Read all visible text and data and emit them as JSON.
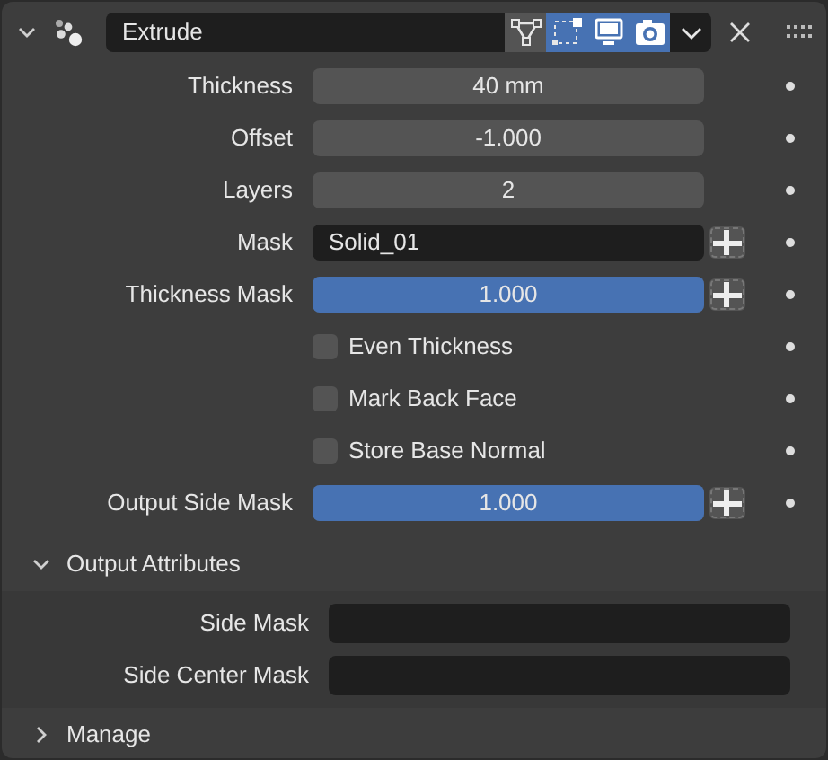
{
  "modifier": {
    "name": "Extrude",
    "expanded": true,
    "toggles": [
      {
        "kind": "on_cage",
        "selected": false
      },
      {
        "kind": "edit_mode",
        "selected": true
      },
      {
        "kind": "viewport",
        "selected": true
      },
      {
        "kind": "render",
        "selected": true
      }
    ]
  },
  "properties": [
    {
      "kind": "number",
      "label": "Thickness",
      "value": "40 mm"
    },
    {
      "kind": "number",
      "label": "Offset",
      "value": "-1.000"
    },
    {
      "kind": "number",
      "label": "Layers",
      "value": "2"
    },
    {
      "kind": "vertex_group",
      "label": "Mask",
      "value": "Solid_01"
    },
    {
      "kind": "slider",
      "label": "Thickness Mask",
      "value": "1.000",
      "level": 1
    },
    {
      "kind": "checkbox",
      "label": "Even Thickness",
      "checked": false
    },
    {
      "kind": "checkbox",
      "label": "Mark Back Face",
      "checked": false
    },
    {
      "kind": "checkbox",
      "label": "Store Base Normal",
      "checked": false
    },
    {
      "kind": "slider",
      "label": "Output Side Mask",
      "value": "1.000",
      "level": 1
    }
  ],
  "sections": [
    {
      "title": "Output Attributes",
      "expanded": true,
      "fields": [
        {
          "label": "Side Mask"
        },
        {
          "label": "Side Center Mask"
        }
      ]
    },
    {
      "title": "Manage",
      "expanded": false
    }
  ]
}
